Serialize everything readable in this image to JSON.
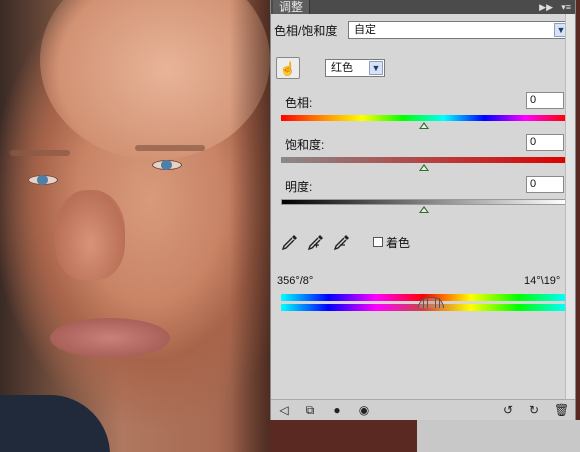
{
  "panel": {
    "tab_title": "调整",
    "preset_label": "色相/饱和度",
    "preset_value": "自定",
    "channel_value": "红色",
    "hue_label": "色相:",
    "hue_value": "0",
    "saturation_label": "饱和度:",
    "saturation_value": "0",
    "lightness_label": "明度:",
    "lightness_value": "0",
    "colorize_label": "着色",
    "colorize_checked": false,
    "range_left": "356°/8°",
    "range_right": "14°\\19°"
  },
  "sliders": {
    "hue_position": 0.5,
    "saturation_position": 0.5,
    "lightness_position": 0.5
  },
  "icons": {
    "collapse": "double-chevron-right-icon",
    "panel_menu": "panel-menu-icon",
    "hand": "targeted-adjustment-hand-icon",
    "eyedropper": "eyedropper-icon",
    "eyedropper_plus": "eyedropper-plus-icon",
    "eyedropper_minus": "eyedropper-minus-icon",
    "footer": [
      "back-arrow-icon",
      "clip-to-layer-icon",
      "layer-visibility-icon",
      "eye-icon",
      "previous-state-icon",
      "reset-icon",
      "trash-icon"
    ]
  },
  "colors": {
    "panel_bg": "#d6d6d6",
    "header_bg": "#4b4b4b",
    "thumb": "#2f6a2f"
  }
}
